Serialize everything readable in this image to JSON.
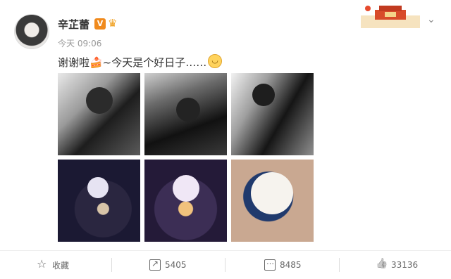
{
  "user": {
    "name": "辛芷蕾",
    "badge": "V",
    "timestamp": "今天 09:06"
  },
  "post": {
    "text": "谢谢啦🍰~今天是个好日子……",
    "images": [
      {
        "name": "photo-1"
      },
      {
        "name": "photo-2"
      },
      {
        "name": "photo-3"
      },
      {
        "name": "photo-4"
      },
      {
        "name": "photo-5"
      },
      {
        "name": "photo-6"
      }
    ]
  },
  "actions": {
    "favorite_label": "收藏",
    "share_count": "5405",
    "comment_count": "8485",
    "like_count": "33136"
  },
  "icons": {
    "favorite": "star-icon",
    "share": "share-icon",
    "comment": "comment-icon",
    "like": "thumbs-up-icon",
    "more": "chevron-down-icon"
  },
  "colors": {
    "badge": "#f08a1d",
    "text": "#333333",
    "muted": "#999999"
  }
}
